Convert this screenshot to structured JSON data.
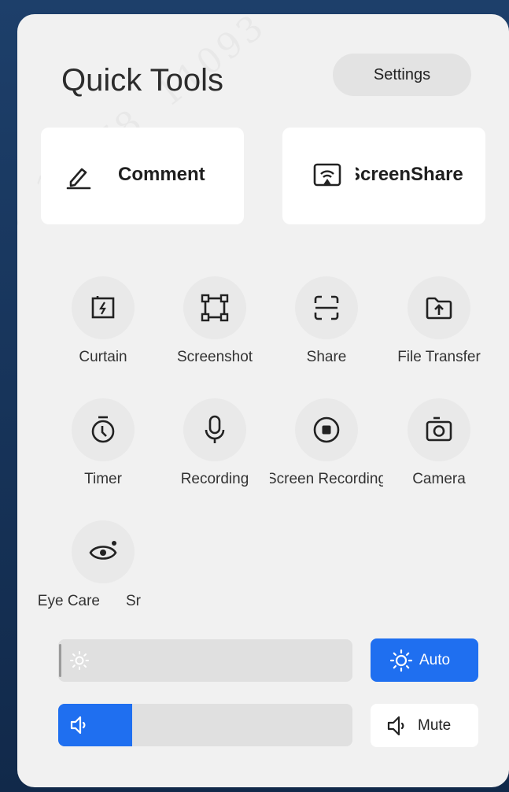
{
  "header": {
    "title": "Quick Tools",
    "settings_label": "Settings"
  },
  "primary_actions": [
    {
      "label": "Comment",
      "icon": "pen-icon"
    },
    {
      "label": "ScreenShare",
      "icon": "cast-icon"
    }
  ],
  "tools": [
    {
      "label": "Curtain",
      "icon": "curtain-icon"
    },
    {
      "label": "Screenshot",
      "icon": "crop-frame-icon"
    },
    {
      "label": "Share",
      "icon": "scan-icon"
    },
    {
      "label": "File Transfer",
      "icon": "folder-upload-icon"
    },
    {
      "label": "Timer",
      "icon": "stopwatch-icon"
    },
    {
      "label": "Recording",
      "icon": "microphone-icon"
    },
    {
      "label": "Screen Recording",
      "icon": "record-icon"
    },
    {
      "label": "Camera",
      "icon": "camera-icon"
    },
    {
      "label": "Eye Care",
      "icon": "eye-icon"
    },
    {
      "label": "Sr",
      "icon": ""
    }
  ],
  "controls": {
    "brightness": {
      "icon": "sun-icon",
      "level": 0.0
    },
    "auto_label": "Auto",
    "volume": {
      "icon": "speaker-icon",
      "level": 0.25
    },
    "mute_label": "Mute"
  },
  "colors": {
    "accent": "#1f6ff0",
    "panel": "#f1f1f1",
    "card": "#ffffff"
  }
}
